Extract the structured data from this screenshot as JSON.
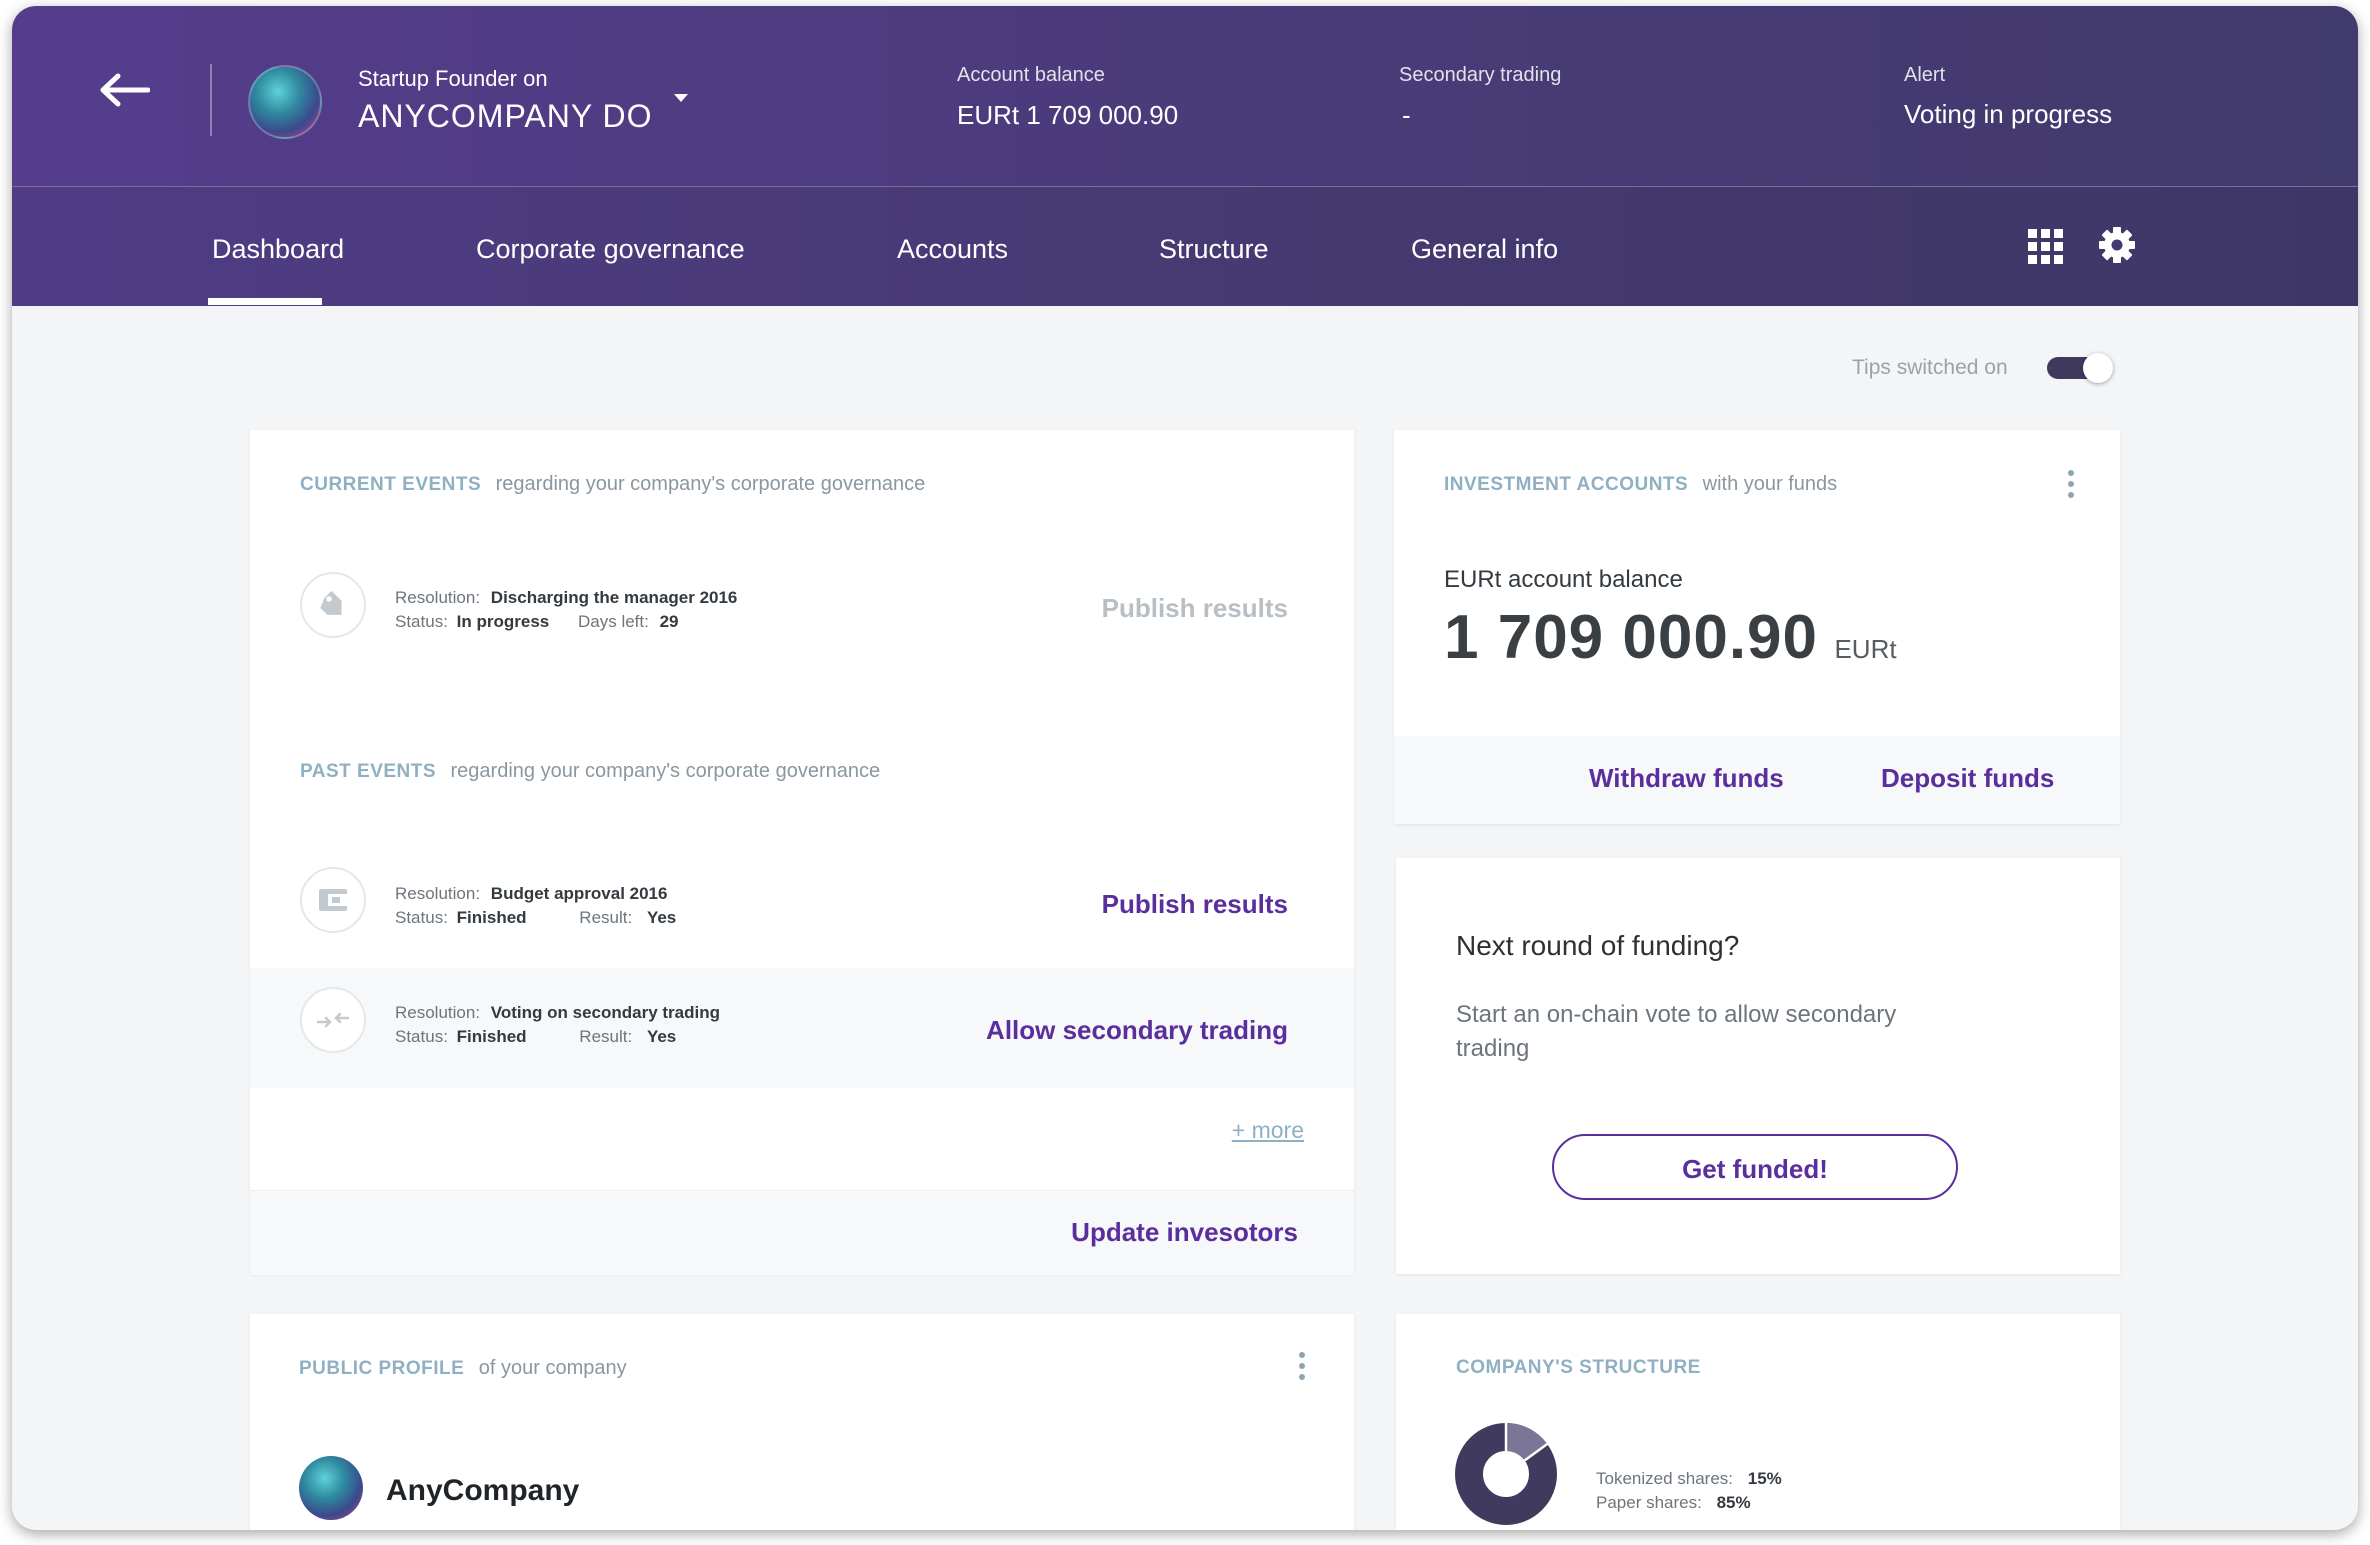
{
  "header": {
    "role": "Startup Founder on",
    "company": "ANYCOMPANY DO",
    "account_balance_label": "Account balance",
    "account_balance_value": "EURt 1 709 000.90",
    "secondary_trading_label": "Secondary trading",
    "secondary_trading_value": "-",
    "alert_label": "Alert",
    "alert_value": "Voting  in progress"
  },
  "nav": {
    "tabs": [
      {
        "label": "Dashboard"
      },
      {
        "label": "Corporate governance"
      },
      {
        "label": "Accounts"
      },
      {
        "label": "Structure"
      },
      {
        "label": "General info"
      }
    ],
    "active_tab": "Dashboard"
  },
  "tips": {
    "label": "Tips switched on",
    "enabled": true
  },
  "current_events": {
    "title": "CURRENT EVENTS",
    "subtitle": "regarding your company's corporate governance",
    "items": [
      {
        "icon": "tag-icon",
        "resolution_label": "Resolution:",
        "resolution": "Discharging the manager 2016",
        "status_label": "Status:",
        "status": "In progress",
        "extra_label": "Days left:",
        "extra_value": "29",
        "action": "Publish results",
        "action_enabled": false
      }
    ]
  },
  "past_events": {
    "title": "PAST EVENTS",
    "subtitle": "regarding your company's corporate governance",
    "items": [
      {
        "icon": "wallet-icon",
        "resolution_label": "Resolution:",
        "resolution": "Budget approval 2016",
        "status_label": "Status:",
        "status": "Finished",
        "extra_label": "Result:",
        "extra_value": "Yes",
        "action": "Publish results",
        "action_enabled": true
      },
      {
        "icon": "transfer-arrows-icon",
        "resolution_label": "Resolution:",
        "resolution": "Voting on secondary trading",
        "status_label": "Status:",
        "status": "Finished",
        "extra_label": "Result:",
        "extra_value": "Yes",
        "action": "Allow secondary trading",
        "action_enabled": true
      }
    ],
    "more": "+ more",
    "footer_action": "Update invesotors"
  },
  "investment_accounts": {
    "title": "INVESTMENT ACCOUNTS",
    "subtitle": "with your funds",
    "balance_label": "EURt account balance",
    "balance_value": "1 709 000.90",
    "currency": "EURt",
    "withdraw": "Withdraw funds",
    "deposit": "Deposit funds"
  },
  "funding": {
    "title": "Next round of funding?",
    "text": "Start an on-chain vote to allow secondary trading",
    "button": "Get funded!"
  },
  "public_profile": {
    "title": "PUBLIC PROFILE",
    "subtitle": "of your company",
    "company_name": "AnyCompany"
  },
  "structure": {
    "title": "COMPANY'S STRUCTURE",
    "tokenized_label": "Tokenized shares:",
    "tokenized_value": "15%",
    "tokenized_fraction": 0.15,
    "paper_label": "Paper shares:",
    "paper_value": "85%",
    "paper_fraction": 0.85
  },
  "colors": {
    "header_start": "#553d8c",
    "header_end": "#413a6c",
    "accent": "#5b2e9e",
    "section_title": "#8fb0c2",
    "donut_main": "#3f3a5e"
  }
}
